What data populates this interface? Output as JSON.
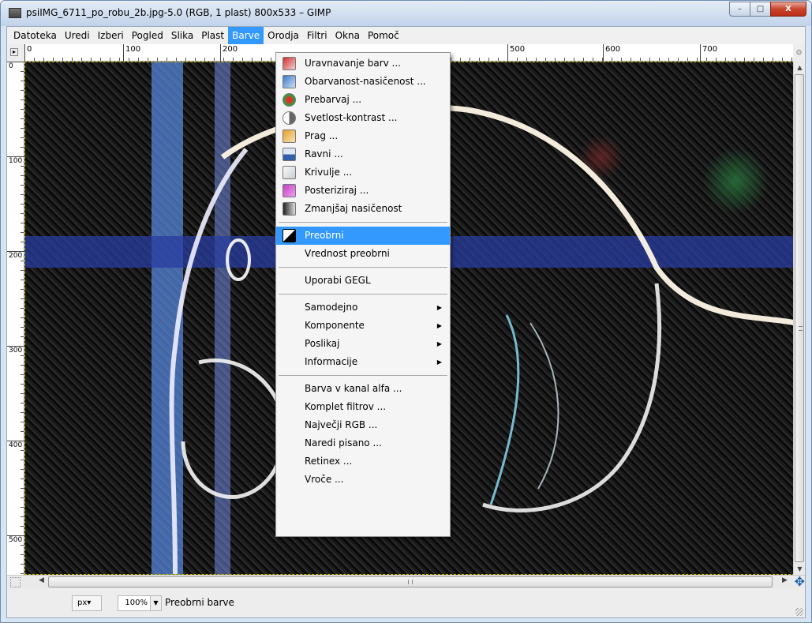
{
  "window": {
    "title": "psiIMG_6711_po_robu_2b.jpg-5.0 (RGB, 1 plast) 800x533 – GIMP",
    "minimize": "–",
    "maximize": "□",
    "close": "X"
  },
  "menubar": [
    "Datoteka",
    "Uredi",
    "Izberi",
    "Pogled",
    "Slika",
    "Plast",
    "Barve",
    "Orodja",
    "Filtri",
    "Okna",
    "Pomoč"
  ],
  "active_menu": "Barve",
  "ruler": {
    "h_ticks": [
      "0",
      "100",
      "200",
      "500",
      "600",
      "700"
    ],
    "v_ticks": [
      "0",
      "100",
      "200",
      "300",
      "400",
      "500"
    ]
  },
  "barve_menu": {
    "group1": [
      {
        "label": "Uravnavanje barv ...",
        "icon": "color-balance-icon",
        "color": "#d03030"
      },
      {
        "label": "Obarvanost-nasičenost ...",
        "icon": "hue-saturation-icon",
        "color": "#3a78c8"
      },
      {
        "label": "Prebarvaj ...",
        "icon": "colorize-icon",
        "color": "#b03070"
      },
      {
        "label": "Svetlost-kontrast ...",
        "icon": "brightness-contrast-icon",
        "color": "#888888"
      },
      {
        "label": "Prag ...",
        "icon": "threshold-icon",
        "color": "#e8a030"
      },
      {
        "label": "Ravni ...",
        "icon": "levels-icon",
        "color": "#3060a8"
      },
      {
        "label": "Krivulje ...",
        "icon": "curves-icon",
        "color": "#9aa0a8"
      },
      {
        "label": "Posteriziraj ...",
        "icon": "posterize-icon",
        "color": "#c040c0"
      },
      {
        "label": "Zmanjšaj nasičenost",
        "icon": "desaturate-icon",
        "color": "#444444"
      }
    ],
    "group2": [
      {
        "label": "Preobrni",
        "icon": "invert-icon",
        "highlighted": true
      },
      {
        "label": "Vrednost preobrni"
      }
    ],
    "group3": [
      {
        "label": "Uporabi GEGL"
      }
    ],
    "group4": [
      {
        "label": "Samodejno",
        "submenu": "▶"
      },
      {
        "label": "Komponente",
        "submenu": "▶"
      },
      {
        "label": "Poslikaj",
        "submenu": "▶"
      },
      {
        "label": "Informacije",
        "submenu": "▶"
      }
    ],
    "group5": [
      {
        "label": "Barva v kanal alfa ..."
      },
      {
        "label": "Komplet filtrov ..."
      },
      {
        "label": "Največji RGB ..."
      },
      {
        "label": "Naredi pisano ..."
      },
      {
        "label": "Retinex ..."
      },
      {
        "label": "Vroče ..."
      }
    ]
  },
  "statusbar": {
    "unit": "px",
    "zoom": "100%",
    "message": "Preobrni barve"
  },
  "scroll": {
    "h_grip": "III",
    "v_grip": "≡"
  }
}
